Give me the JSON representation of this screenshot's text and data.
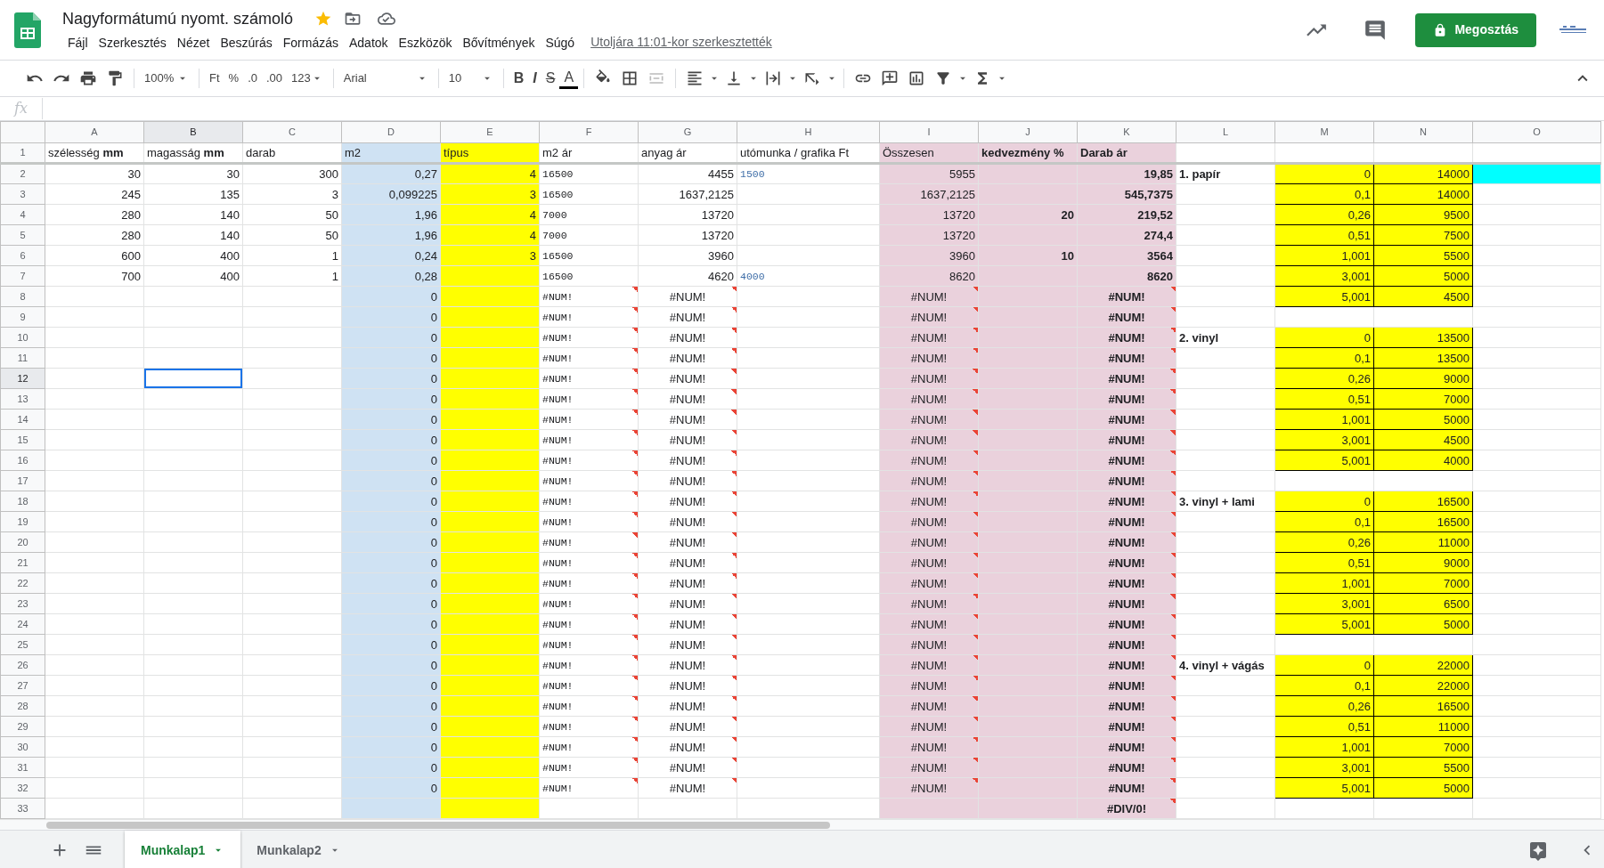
{
  "title": "Nagyformátumú nyomt. számoló",
  "starred": true,
  "menu": [
    "Fájl",
    "Szerkesztés",
    "Nézet",
    "Beszúrás",
    "Formázás",
    "Adatok",
    "Eszközök",
    "Bővítmények",
    "Súgó"
  ],
  "last_edit": "Utoljára 11:01-kor szerkesztették",
  "share_button": "Megosztás",
  "toolbar": {
    "zoom": "100%",
    "currency": "Ft",
    "percent": "%",
    "decrease_decimals": ".0",
    "increase_decimals": ".00",
    "number_format": "123",
    "font": "Arial",
    "font_size": "10",
    "bold": "B",
    "italic": "I",
    "strikethrough": "S",
    "text_color": "A"
  },
  "formula_bar": {
    "label": "fx"
  },
  "columns": [
    "A",
    "B",
    "C",
    "D",
    "E",
    "F",
    "G",
    "H",
    "I",
    "J",
    "K",
    "L",
    "M",
    "N",
    "O"
  ],
  "rows": [
    {
      "number": "1",
      "cells": [
        "szélesség **mm**",
        "magasság **mm**",
        "darab",
        "m2",
        "típus",
        "m2 ár",
        "anyag ár",
        "utómunka / grafika Ft",
        "Összesen",
        "kedvezmény %",
        "Darab ár",
        null,
        null,
        null,
        null
      ]
    },
    {
      "number": "2",
      "cells": [
        "30",
        "30",
        "300",
        "0,27",
        "4",
        "16500",
        "4455",
        "1500",
        "5955",
        null,
        "19,85",
        "1. papír",
        "0",
        "14000",
        {
          "color": "#00ffff"
        }
      ]
    },
    {
      "number": "3",
      "cells": [
        "245",
        "135",
        "3",
        "0,099225",
        "3",
        "16500",
        "1637,2125",
        null,
        "1637,2125",
        null,
        "545,7375",
        null,
        "0,1",
        "14000",
        null
      ]
    },
    {
      "number": "4",
      "cells": [
        "280",
        "140",
        "50",
        "1,96",
        "4",
        "7000",
        "13720",
        null,
        "13720",
        "20",
        "219,52",
        null,
        "0,26",
        "9500",
        null
      ]
    },
    {
      "number": "5",
      "cells": [
        "280",
        "140",
        "50",
        "1,96",
        "4",
        "7000",
        "13720",
        null,
        "13720",
        null,
        "274,4",
        null,
        "0,51",
        "7500",
        null
      ]
    },
    {
      "number": "6",
      "cells": [
        "600",
        "400",
        "1",
        "0,24",
        "3",
        "16500",
        "3960",
        null,
        "3960",
        "10",
        "3564",
        null,
        "1,001",
        "5500",
        null
      ]
    },
    {
      "number": "7",
      "cells": [
        "700",
        "400",
        "1",
        "0,28",
        null,
        "16500",
        "4620",
        "4000",
        "8620",
        null,
        "8620",
        null,
        "3,001",
        "5000",
        null
      ]
    },
    {
      "number": "8",
      "cells": [
        null,
        null,
        null,
        "0",
        null,
        {
          "text": "#NUM!",
          "error": true
        },
        {
          "text": "#NUM!",
          "error": true
        },
        null,
        {
          "text": "#NUM!",
          "error": true
        },
        null,
        {
          "text": "#NUM!",
          "error": true
        },
        null,
        "5,001",
        "4500",
        null
      ]
    },
    {
      "number": "9",
      "cells": [
        null,
        null,
        null,
        "0",
        null,
        {
          "text": "#NUM!",
          "error": true
        },
        {
          "text": "#NUM!",
          "error": true
        },
        null,
        {
          "text": "#NUM!",
          "error": true
        },
        null,
        {
          "text": "#NUM!",
          "error": true
        },
        null,
        null,
        null,
        null
      ]
    },
    {
      "number": "10",
      "cells": [
        null,
        null,
        null,
        "0",
        null,
        {
          "text": "#NUM!",
          "error": true
        },
        {
          "text": "#NUM!",
          "error": true
        },
        null,
        {
          "text": "#NUM!",
          "error": true
        },
        null,
        {
          "text": "#NUM!",
          "error": true
        },
        "2. vinyl",
        "0",
        "13500",
        null
      ]
    },
    {
      "number": "11",
      "cells": [
        null,
        null,
        null,
        "0",
        null,
        {
          "text": "#NUM!",
          "error": true
        },
        {
          "text": "#NUM!",
          "error": true
        },
        null,
        {
          "text": "#NUM!",
          "error": true
        },
        null,
        {
          "text": "#NUM!",
          "error": true
        },
        null,
        "0,1",
        "13500",
        null
      ]
    },
    {
      "number": "12",
      "cells": [
        null,
        {
          "selected": true
        },
        null,
        "0",
        null,
        {
          "text": "#NUM!",
          "error": true
        },
        {
          "text": "#NUM!",
          "error": true
        },
        null,
        {
          "text": "#NUM!",
          "error": true
        },
        null,
        {
          "text": "#NUM!",
          "error": true
        },
        null,
        "0,26",
        "9000",
        null
      ]
    },
    {
      "number": "13",
      "cells": [
        null,
        null,
        null,
        "0",
        null,
        {
          "text": "#NUM!",
          "error": true
        },
        {
          "text": "#NUM!",
          "error": true
        },
        null,
        {
          "text": "#NUM!",
          "error": true
        },
        null,
        {
          "text": "#NUM!",
          "error": true
        },
        null,
        "0,51",
        "7000",
        null
      ]
    },
    {
      "number": "14",
      "cells": [
        null,
        null,
        null,
        "0",
        null,
        {
          "text": "#NUM!",
          "error": true
        },
        {
          "text": "#NUM!",
          "error": true
        },
        null,
        {
          "text": "#NUM!",
          "error": true
        },
        null,
        {
          "text": "#NUM!",
          "error": true
        },
        null,
        "1,001",
        "5000",
        null
      ]
    },
    {
      "number": "15",
      "cells": [
        null,
        null,
        null,
        "0",
        null,
        {
          "text": "#NUM!",
          "error": true
        },
        {
          "text": "#NUM!",
          "error": true
        },
        null,
        {
          "text": "#NUM!",
          "error": true
        },
        null,
        {
          "text": "#NUM!",
          "error": true
        },
        null,
        "3,001",
        "4500",
        null
      ]
    },
    {
      "number": "16",
      "cells": [
        null,
        null,
        null,
        "0",
        null,
        {
          "text": "#NUM!",
          "error": true
        },
        {
          "text": "#NUM!",
          "error": true
        },
        null,
        {
          "text": "#NUM!",
          "error": true
        },
        null,
        {
          "text": "#NUM!",
          "error": true
        },
        null,
        "5,001",
        "4000",
        null
      ]
    },
    {
      "number": "17",
      "cells": [
        null,
        null,
        null,
        "0",
        null,
        {
          "text": "#NUM!",
          "error": true
        },
        {
          "text": "#NUM!",
          "error": true
        },
        null,
        {
          "text": "#NUM!",
          "error": true
        },
        null,
        {
          "text": "#NUM!",
          "error": true
        },
        null,
        null,
        null,
        null
      ]
    },
    {
      "number": "18",
      "cells": [
        null,
        null,
        null,
        "0",
        null,
        {
          "text": "#NUM!",
          "error": true
        },
        {
          "text": "#NUM!",
          "error": true
        },
        null,
        {
          "text": "#NUM!",
          "error": true
        },
        null,
        {
          "text": "#NUM!",
          "error": true
        },
        "3. vinyl + lami",
        "0",
        "16500",
        null
      ]
    },
    {
      "number": "19",
      "cells": [
        null,
        null,
        null,
        "0",
        null,
        {
          "text": "#NUM!",
          "error": true
        },
        {
          "text": "#NUM!",
          "error": true
        },
        null,
        {
          "text": "#NUM!",
          "error": true
        },
        null,
        {
          "text": "#NUM!",
          "error": true
        },
        null,
        "0,1",
        "16500",
        null
      ]
    },
    {
      "number": "20",
      "cells": [
        null,
        null,
        null,
        "0",
        null,
        {
          "text": "#NUM!",
          "error": true
        },
        {
          "text": "#NUM!",
          "error": true
        },
        null,
        {
          "text": "#NUM!",
          "error": true
        },
        null,
        {
          "text": "#NUM!",
          "error": true
        },
        null,
        "0,26",
        "11000",
        null
      ]
    },
    {
      "number": "21",
      "cells": [
        null,
        null,
        null,
        "0",
        null,
        {
          "text": "#NUM!",
          "error": true
        },
        {
          "text": "#NUM!",
          "error": true
        },
        null,
        {
          "text": "#NUM!",
          "error": true
        },
        null,
        {
          "text": "#NUM!",
          "error": true
        },
        null,
        "0,51",
        "9000",
        null
      ]
    },
    {
      "number": "22",
      "cells": [
        null,
        null,
        null,
        "0",
        null,
        {
          "text": "#NUM!",
          "error": true
        },
        {
          "text": "#NUM!",
          "error": true
        },
        null,
        {
          "text": "#NUM!",
          "error": true
        },
        null,
        {
          "text": "#NUM!",
          "error": true
        },
        null,
        "1,001",
        "7000",
        null
      ]
    },
    {
      "number": "23",
      "cells": [
        null,
        null,
        null,
        "0",
        null,
        {
          "text": "#NUM!",
          "error": true
        },
        {
          "text": "#NUM!",
          "error": true
        },
        null,
        {
          "text": "#NUM!",
          "error": true
        },
        null,
        {
          "text": "#NUM!",
          "error": true
        },
        null,
        "3,001",
        "6500",
        null
      ]
    },
    {
      "number": "24",
      "cells": [
        null,
        null,
        null,
        "0",
        null,
        {
          "text": "#NUM!",
          "error": true
        },
        {
          "text": "#NUM!",
          "error": true
        },
        null,
        {
          "text": "#NUM!",
          "error": true
        },
        null,
        {
          "text": "#NUM!",
          "error": true
        },
        null,
        "5,001",
        "5000",
        null
      ]
    },
    {
      "number": "25",
      "cells": [
        null,
        null,
        null,
        "0",
        null,
        {
          "text": "#NUM!",
          "error": true
        },
        {
          "text": "#NUM!",
          "error": true
        },
        null,
        {
          "text": "#NUM!",
          "error": true
        },
        null,
        {
          "text": "#NUM!",
          "error": true
        },
        null,
        null,
        null,
        null
      ]
    },
    {
      "number": "26",
      "cells": [
        null,
        null,
        null,
        "0",
        null,
        {
          "text": "#NUM!",
          "error": true
        },
        {
          "text": "#NUM!",
          "error": true
        },
        null,
        {
          "text": "#NUM!",
          "error": true
        },
        null,
        {
          "text": "#NUM!",
          "error": true
        },
        "4. vinyl + vágás",
        "0",
        "22000",
        null
      ]
    },
    {
      "number": "27",
      "cells": [
        null,
        null,
        null,
        "0",
        null,
        {
          "text": "#NUM!",
          "error": true
        },
        {
          "text": "#NUM!",
          "error": true
        },
        null,
        {
          "text": "#NUM!",
          "error": true
        },
        null,
        {
          "text": "#NUM!",
          "error": true
        },
        null,
        "0,1",
        "22000",
        null
      ]
    },
    {
      "number": "28",
      "cells": [
        null,
        null,
        null,
        "0",
        null,
        {
          "text": "#NUM!",
          "error": true
        },
        {
          "text": "#NUM!",
          "error": true
        },
        null,
        {
          "text": "#NUM!",
          "error": true
        },
        null,
        {
          "text": "#NUM!",
          "error": true
        },
        null,
        "0,26",
        "16500",
        null
      ]
    },
    {
      "number": "29",
      "cells": [
        null,
        null,
        null,
        "0",
        null,
        {
          "text": "#NUM!",
          "error": true
        },
        {
          "text": "#NUM!",
          "error": true
        },
        null,
        {
          "text": "#NUM!",
          "error": true
        },
        null,
        {
          "text": "#NUM!",
          "error": true
        },
        null,
        "0,51",
        "11000",
        null
      ]
    },
    {
      "number": "30",
      "cells": [
        null,
        null,
        null,
        "0",
        null,
        {
          "text": "#NUM!",
          "error": true
        },
        {
          "text": "#NUM!",
          "error": true
        },
        null,
        {
          "text": "#NUM!",
          "error": true
        },
        null,
        {
          "text": "#NUM!",
          "error": true
        },
        null,
        "1,001",
        "7000",
        null
      ]
    },
    {
      "number": "31",
      "cells": [
        null,
        null,
        null,
        "0",
        null,
        {
          "text": "#NUM!",
          "error": true
        },
        {
          "text": "#NUM!",
          "error": true
        },
        null,
        {
          "text": "#NUM!",
          "error": true
        },
        null,
        {
          "text": "#NUM!",
          "error": true
        },
        null,
        "3,001",
        "5500",
        null
      ]
    },
    {
      "number": "32",
      "cells": [
        null,
        null,
        null,
        "0",
        null,
        {
          "text": "#NUM!",
          "error": true
        },
        {
          "text": "#NUM!",
          "error": true
        },
        null,
        {
          "text": "#NUM!",
          "error": true
        },
        null,
        {
          "text": "#NUM!",
          "error": true
        },
        null,
        "5,001",
        "5000",
        null
      ]
    },
    {
      "number": "33",
      "cells": [
        null,
        null,
        null,
        null,
        null,
        null,
        null,
        null,
        null,
        null,
        {
          "text": "#DIV/0!",
          "error": true
        },
        null,
        null,
        null,
        null
      ]
    }
  ],
  "sheet_tabs": [
    {
      "label": "Munkalap1",
      "selected": true
    },
    {
      "label": "Munkalap2",
      "selected": false
    }
  ]
}
